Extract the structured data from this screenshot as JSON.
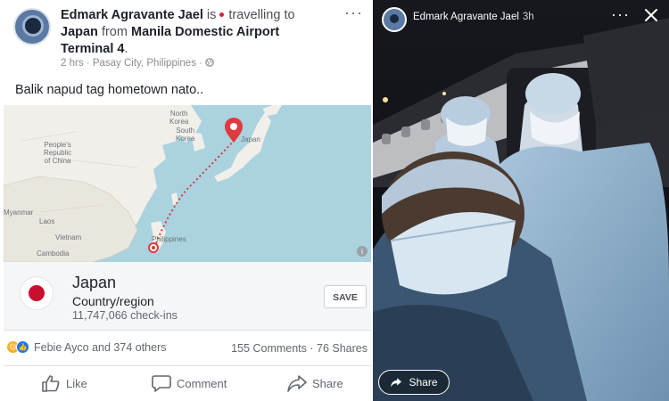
{
  "post": {
    "author": "Edmark Agravante Jael",
    "verb": "is",
    "activity": "travelling",
    "to_word": "to",
    "destination": "Japan",
    "from_word": "from",
    "origin": "Manila Domestic Airport Terminal 4",
    "period": ".",
    "time": "2 hrs",
    "separator": "·",
    "location": "Pasay City, Philippines",
    "more": "···",
    "text": "Balik napud tag hometown nato.."
  },
  "map": {
    "labels": {
      "north_korea": "North\nKorea",
      "south_korea": "South\nKorea",
      "japan": "Japan",
      "china": "People's\nRepublic\nof China",
      "myanmar": "Myanmar",
      "laos": "Laos",
      "vietnam": "Vietnam",
      "cambodia": "Cambodia",
      "philippines": "Philippines"
    },
    "info": "i"
  },
  "place": {
    "name": "Japan",
    "category": "Country/region",
    "checkins": "11,747,066 check-ins",
    "save_label": "SAVE"
  },
  "engagement": {
    "reactors": "Febie Ayco and 374 others",
    "counts": "155 Comments · 76 Shares"
  },
  "actions": {
    "like": "Like",
    "comment": "Comment",
    "share": "Share"
  },
  "story": {
    "author": "Edmark Agravante Jael",
    "time": "3h",
    "more": "···",
    "share_label": "Share"
  },
  "colors": {
    "facebook_blue": "#1877f2",
    "map_pin": "#e0393e",
    "flag_red": "#c8102e"
  }
}
